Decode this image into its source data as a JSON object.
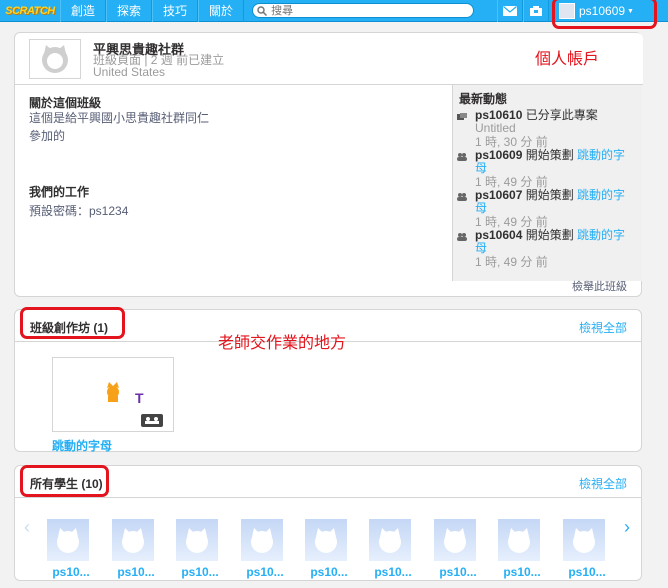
{
  "nav": {
    "logo": "SCRATCH",
    "items": [
      "創造",
      "探索",
      "技巧",
      "關於"
    ],
    "search_placeholder": "搜尋",
    "username": "ps10609"
  },
  "class": {
    "title": "平興思貴趣社群",
    "meta_line1": "班級頁面 | 2 週 前已建立",
    "meta_line2": "United States",
    "annotation": "個人帳戶"
  },
  "about": {
    "title": "關於這個班級",
    "text_line1": "這個是給平興國小思貴趣社群同仁",
    "text_line2": "參加的"
  },
  "work": {
    "title": "我們的工作",
    "text": "預設密碼：ps1234"
  },
  "activity": {
    "title": "最新動態",
    "items": [
      {
        "user": "ps10610",
        "action": " 已分享此專案",
        "link": "Untitled",
        "time": "1 時, 30 分 前"
      },
      {
        "user": "ps10609",
        "action": " 開始策劃 ",
        "link": "跳動的字母",
        "time": "1 時, 49 分 前"
      },
      {
        "user": "ps10607",
        "action": " 開始策劃 ",
        "link": "跳動的字母",
        "time": "1 時, 49 分 前"
      },
      {
        "user": "ps10604",
        "action": " 開始策劃 ",
        "link": "跳動的字母",
        "time": "1 時, 49 分 前"
      }
    ],
    "report": "檢舉此班級"
  },
  "studios": {
    "title": "班級創作坊 (1)",
    "view_all": "檢視全部",
    "annotation": "老師交作業的地方",
    "studio_name": "跳動的字母"
  },
  "students": {
    "title": "所有學生 (10)",
    "view_all": "檢視全部",
    "names": [
      "ps10...",
      "ps10...",
      "ps10...",
      "ps10...",
      "ps10...",
      "ps10...",
      "ps10...",
      "ps10...",
      "ps10..."
    ]
  },
  "colors": {
    "accent": "#25aff4",
    "annotation": "#e3141d"
  }
}
